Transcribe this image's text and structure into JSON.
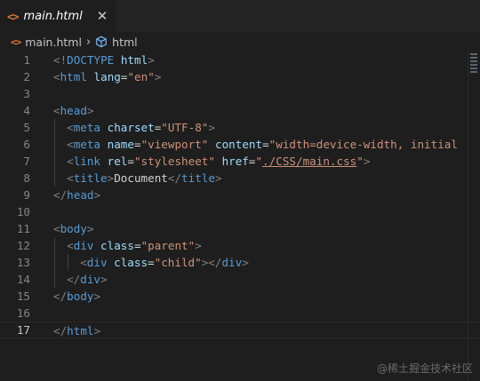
{
  "tab": {
    "icon": "<>",
    "title": "main.html",
    "close_glyph": "✕"
  },
  "breadcrumb": {
    "file": "main.html",
    "separator": "›",
    "symbol": "html"
  },
  "colors": {
    "tag": "#569cd6",
    "attribute": "#9cdcfe",
    "string": "#ce9178",
    "punctuation": "#808080",
    "html_icon": "#e37933"
  },
  "editor": {
    "current_line": 17,
    "lines": [
      {
        "n": "1",
        "indent": 0,
        "tokens": [
          [
            "punc",
            "<!"
          ],
          [
            "tag",
            "DOCTYPE"
          ],
          [
            "ws",
            " "
          ],
          [
            "attr",
            "html"
          ],
          [
            "punc",
            ">"
          ]
        ]
      },
      {
        "n": "2",
        "indent": 0,
        "tokens": [
          [
            "punc",
            "<"
          ],
          [
            "tag",
            "html"
          ],
          [
            "ws",
            " "
          ],
          [
            "attr",
            "lang"
          ],
          [
            "text",
            "="
          ],
          [
            "str",
            "\"en\""
          ],
          [
            "punc",
            ">"
          ]
        ]
      },
      {
        "n": "3",
        "indent": 0,
        "tokens": []
      },
      {
        "n": "4",
        "indent": 0,
        "tokens": [
          [
            "punc",
            "<"
          ],
          [
            "tag",
            "head"
          ],
          [
            "punc",
            ">"
          ]
        ]
      },
      {
        "n": "5",
        "indent": 1,
        "tokens": [
          [
            "punc",
            "<"
          ],
          [
            "tag",
            "meta"
          ],
          [
            "ws",
            " "
          ],
          [
            "attr",
            "charset"
          ],
          [
            "text",
            "="
          ],
          [
            "str",
            "\"UTF-8\""
          ],
          [
            "punc",
            ">"
          ]
        ]
      },
      {
        "n": "6",
        "indent": 1,
        "tokens": [
          [
            "punc",
            "<"
          ],
          [
            "tag",
            "meta"
          ],
          [
            "ws",
            " "
          ],
          [
            "attr",
            "name"
          ],
          [
            "text",
            "="
          ],
          [
            "str",
            "\"viewport\""
          ],
          [
            "ws",
            " "
          ],
          [
            "attr",
            "content"
          ],
          [
            "text",
            "="
          ],
          [
            "str",
            "\"width=device-width, initial"
          ]
        ]
      },
      {
        "n": "7",
        "indent": 1,
        "tokens": [
          [
            "punc",
            "<"
          ],
          [
            "tag",
            "link"
          ],
          [
            "ws",
            " "
          ],
          [
            "attr",
            "rel"
          ],
          [
            "text",
            "="
          ],
          [
            "str",
            "\"stylesheet\""
          ],
          [
            "ws",
            " "
          ],
          [
            "attr",
            "href"
          ],
          [
            "text",
            "="
          ],
          [
            "str",
            "\""
          ],
          [
            "link",
            "./CSS/main.css"
          ],
          [
            "str",
            "\""
          ],
          [
            "punc",
            ">"
          ]
        ]
      },
      {
        "n": "8",
        "indent": 1,
        "tokens": [
          [
            "punc",
            "<"
          ],
          [
            "tag",
            "title"
          ],
          [
            "punc",
            ">"
          ],
          [
            "text",
            "Document"
          ],
          [
            "punc",
            "</"
          ],
          [
            "tag",
            "title"
          ],
          [
            "punc",
            ">"
          ]
        ]
      },
      {
        "n": "9",
        "indent": 0,
        "tokens": [
          [
            "punc",
            "</"
          ],
          [
            "tag",
            "head"
          ],
          [
            "punc",
            ">"
          ]
        ]
      },
      {
        "n": "10",
        "indent": 0,
        "tokens": []
      },
      {
        "n": "11",
        "indent": 0,
        "tokens": [
          [
            "punc",
            "<"
          ],
          [
            "tag",
            "body"
          ],
          [
            "punc",
            ">"
          ]
        ]
      },
      {
        "n": "12",
        "indent": 1,
        "tokens": [
          [
            "punc",
            "<"
          ],
          [
            "tag",
            "div"
          ],
          [
            "ws",
            " "
          ],
          [
            "attr",
            "class"
          ],
          [
            "text",
            "="
          ],
          [
            "str",
            "\"parent\""
          ],
          [
            "punc",
            ">"
          ]
        ]
      },
      {
        "n": "13",
        "indent": 2,
        "tokens": [
          [
            "punc",
            "<"
          ],
          [
            "tag",
            "div"
          ],
          [
            "ws",
            " "
          ],
          [
            "attr",
            "class"
          ],
          [
            "text",
            "="
          ],
          [
            "str",
            "\"child\""
          ],
          [
            "punc",
            "></"
          ],
          [
            "tag",
            "div"
          ],
          [
            "punc",
            ">"
          ]
        ]
      },
      {
        "n": "14",
        "indent": 1,
        "tokens": [
          [
            "punc",
            "</"
          ],
          [
            "tag",
            "div"
          ],
          [
            "punc",
            ">"
          ]
        ]
      },
      {
        "n": "15",
        "indent": 0,
        "tokens": [
          [
            "punc",
            "</"
          ],
          [
            "tag",
            "body"
          ],
          [
            "punc",
            ">"
          ]
        ]
      },
      {
        "n": "16",
        "indent": 0,
        "tokens": []
      },
      {
        "n": "17",
        "indent": 0,
        "tokens": [
          [
            "punc",
            "</"
          ],
          [
            "tag",
            "html"
          ],
          [
            "punc",
            ">"
          ]
        ]
      }
    ]
  },
  "watermark": "@稀土掘金技术社区"
}
